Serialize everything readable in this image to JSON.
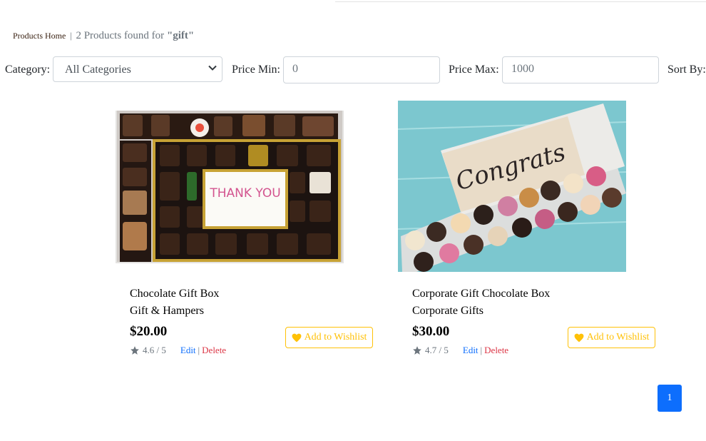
{
  "breadcrumb": {
    "home": "Products Home",
    "separator": "|",
    "found_text": "2 Products found for",
    "query": "\"gift\""
  },
  "filters": {
    "category_label": "Category:",
    "category_value": "All Categories",
    "price_min_label": "Price Min:",
    "price_min_value": "0",
    "price_max_label": "Price Max:",
    "price_max_value": "1000",
    "sort_label": "Sort By:"
  },
  "products": [
    {
      "name": "Chocolate Gift Box",
      "category": "Gift & Hampers",
      "price": "$20.00",
      "rating": "4.6 / 5",
      "edit": "Edit",
      "divider": "|",
      "delete": "Delete",
      "wishlist": "Add to Wishlist",
      "image_text": "THANK YOU"
    },
    {
      "name": "Corporate Gift Chocolate Box",
      "category": "Corporate Gifts",
      "price": "$30.00",
      "rating": "4.7 / 5",
      "edit": "Edit",
      "divider": "|",
      "delete": "Delete",
      "wishlist": "Add to Wishlist",
      "image_text": "Congrats"
    }
  ],
  "pagination": {
    "current": "1"
  },
  "colors": {
    "primary": "#0d6efd",
    "warning": "#ffc107",
    "danger": "#dc3545",
    "muted": "#6c757d"
  },
  "icons": {
    "rating": "star-icon",
    "wishlist": "heart-icon",
    "select": "chevron-down-icon"
  }
}
